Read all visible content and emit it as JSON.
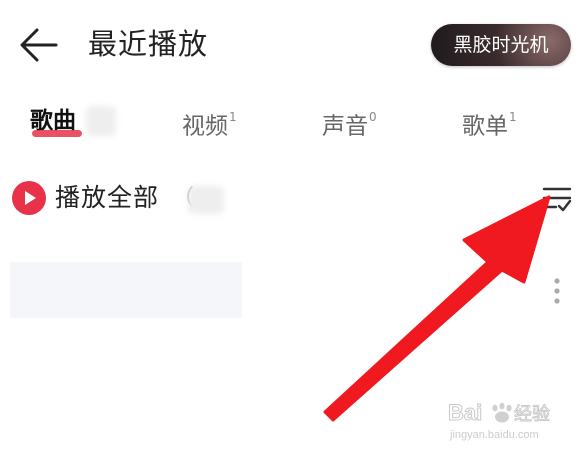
{
  "header": {
    "back_icon": "arrow-left-icon",
    "title": "最近播放",
    "vinyl_button_label": "黑胶时光机"
  },
  "tabs": [
    {
      "label": "歌曲",
      "count": "",
      "active": true
    },
    {
      "label": "视频",
      "count": "1",
      "active": false
    },
    {
      "label": "声音",
      "count": "0",
      "active": false
    },
    {
      "label": "歌单",
      "count": "1",
      "active": false
    }
  ],
  "play_all": {
    "icon": "play-circle-icon",
    "label": "播放全部",
    "paren": "（"
  },
  "sort_icon": "sort-list-icon",
  "more_icon": "more-vertical-icon",
  "colors": {
    "accent": "#e8324a",
    "arrow": "#f0191f",
    "vinyl_button_bg": "#2a2226"
  },
  "watermark": {
    "brand": "Bai",
    "brand_suffix": "经验",
    "url": "jingyan.baidu.com"
  }
}
